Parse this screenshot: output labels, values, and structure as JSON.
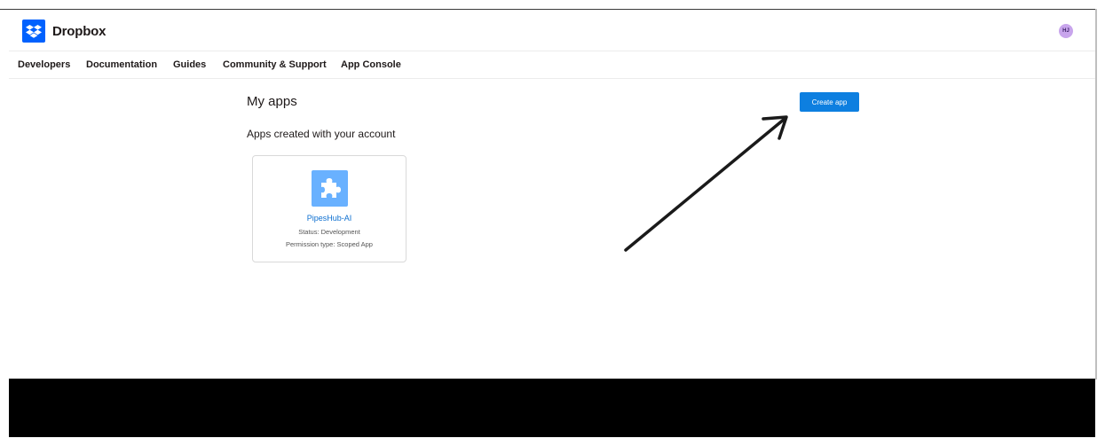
{
  "brand": {
    "name": "Dropbox",
    "color": "#0061fe"
  },
  "user": {
    "initials": "HJ"
  },
  "nav": {
    "items": [
      {
        "label": "Developers"
      },
      {
        "label": "Documentation"
      },
      {
        "label": "Guides"
      },
      {
        "label": "Community & Support"
      },
      {
        "label": "App Console"
      }
    ]
  },
  "main": {
    "title": "My apps",
    "create_button": "Create app",
    "section_label": "Apps created with your account",
    "apps": [
      {
        "name": "PipesHub-AI",
        "status": "Status: Development",
        "permission": "Permission type: Scoped App",
        "icon": "puzzle-icon"
      }
    ]
  },
  "annotation": {
    "icon": "arrow-annotation"
  },
  "colors": {
    "accent_button": "#0d7fe0",
    "app_icon_bg": "#69b1ff",
    "link": "#0d6fd0"
  }
}
